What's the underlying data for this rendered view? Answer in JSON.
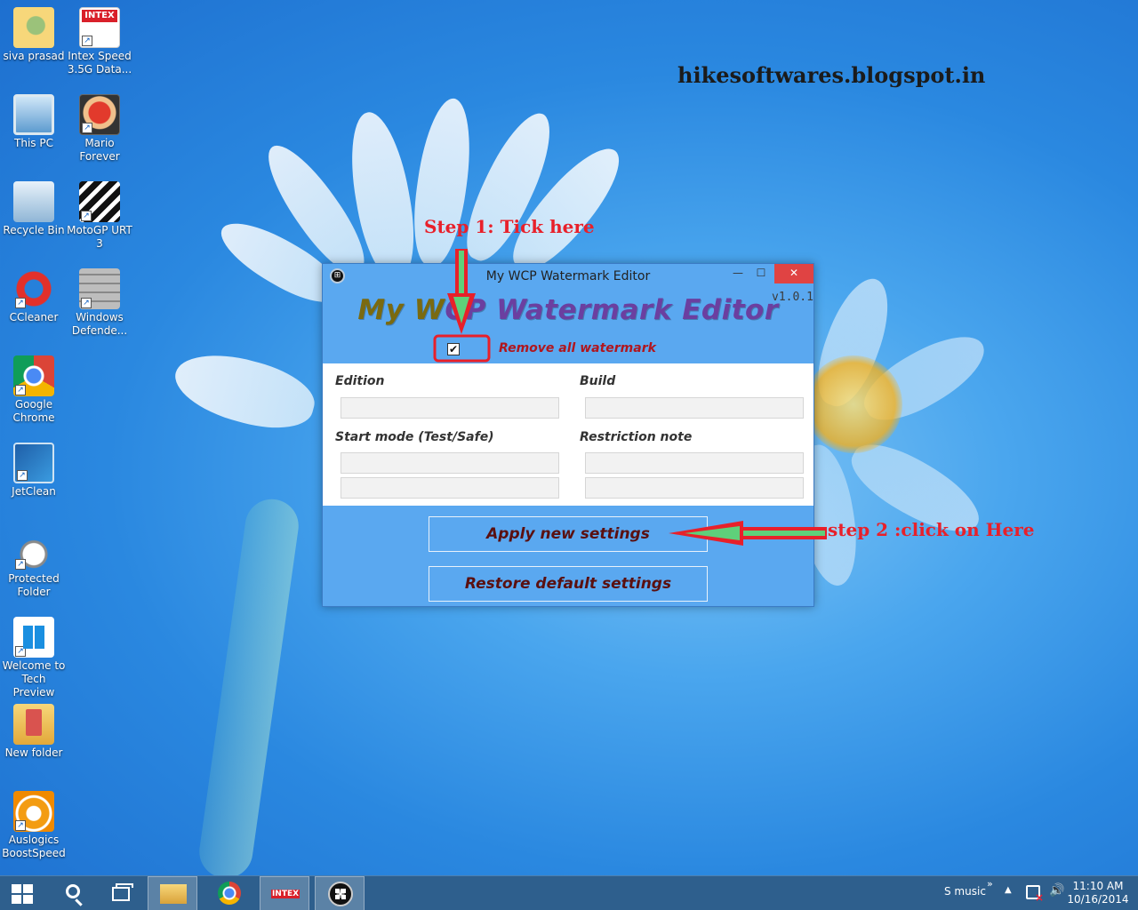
{
  "desktop": {
    "blog_title": "hikesoftwares.blogspot.in",
    "icons": [
      {
        "label": "siva prasad",
        "icon": "user-folder-icon"
      },
      {
        "label": "Intex Speed 3.5G Data...",
        "icon": "intex-icon",
        "logo": "INTEX"
      },
      {
        "label": "This PC",
        "icon": "computer-icon"
      },
      {
        "label": "Mario Forever",
        "icon": "mario-icon"
      },
      {
        "label": "Recycle Bin",
        "icon": "recycle-bin-icon"
      },
      {
        "label": "MotoGP URT 3",
        "icon": "motogp-icon"
      },
      {
        "label": "CCleaner",
        "icon": "ccleaner-icon"
      },
      {
        "label": "Windows Defende...",
        "icon": "windows-defender-icon"
      },
      {
        "label": "Google Chrome",
        "icon": "chrome-icon"
      },
      {
        "label": "JetClean",
        "icon": "jetclean-icon"
      },
      {
        "label": "Protected Folder",
        "icon": "protected-folder-icon"
      },
      {
        "label": "Welcome to Tech Preview",
        "icon": "windows-logo-icon"
      },
      {
        "label": "New folder",
        "icon": "folder-icon"
      },
      {
        "label": "Auslogics BoostSpeed",
        "icon": "boostspeed-icon"
      }
    ]
  },
  "annotations": {
    "step1": "Step 1: Tick here",
    "step2": "step 2 :click on Here",
    "color": "#e8202a"
  },
  "window": {
    "title": "My WCP Watermark Editor",
    "version": "v1.0.1",
    "headline_part1": "My W",
    "headline_part2": "CP Watermark Editor",
    "minimize": "—",
    "maximize": "☐",
    "close": "✕",
    "checkbox": {
      "label": "Remove all watermark",
      "checked": true,
      "mark": "✔"
    },
    "fields": {
      "edition_label": "Edition",
      "edition_value": "",
      "build_label": "Build",
      "build_value": "",
      "start_mode_label": "Start mode (Test/Safe)",
      "start_mode_value_1": "",
      "start_mode_value_2": "",
      "restriction_label": "Restriction note",
      "restriction_value_1": "",
      "restriction_value_2": ""
    },
    "buttons": {
      "apply": "Apply new settings",
      "restore": "Restore default settings"
    },
    "colors": {
      "accent": "#5aa8f0",
      "headline": "#6b3fa0",
      "checkbox_label": "#b0161e"
    }
  },
  "taskbar": {
    "items": [
      "start-icon",
      "search-icon",
      "task-view-icon",
      "file-explorer-icon",
      "chrome-icon",
      "intex-icon",
      "wcp-editor-icon"
    ],
    "intex_logo": "INTEX",
    "tray_label": "S music",
    "tray_chevron": "»",
    "tray_up": "▲",
    "volume": "🔊",
    "time": "11:10 AM",
    "date": "10/16/2014"
  }
}
